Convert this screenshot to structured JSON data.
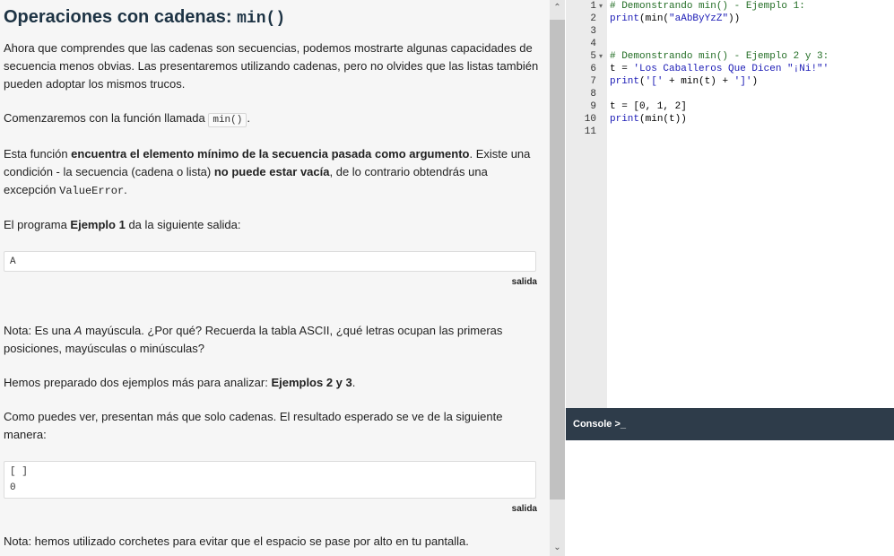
{
  "lesson": {
    "title_text": "Operaciones con cadenas: ",
    "title_code": "min()",
    "p1": "Ahora que comprendes que las cadenas son secuencias, podemos mostrarte algunas capacidades de secuencia menos obvias. Las presentaremos utilizando cadenas, pero no olvides que las listas también pueden adoptar los mismos trucos.",
    "p2_pre": "Comenzaremos con la función llamada ",
    "p2_code": "min()",
    "p2_post": ".",
    "p3_a": "Esta función ",
    "p3_b": "encuentra el elemento mínimo de la secuencia pasada como argumento",
    "p3_c": ". Existe una condición - la secuencia (cadena o lista) ",
    "p3_d": "no puede estar vacía",
    "p3_e": ", de lo contrario obtendrás una excepción ",
    "p3_code": "ValueError",
    "p3_f": ".",
    "p4_a": "El programa ",
    "p4_b": "Ejemplo 1",
    "p4_c": " da la siguiente salida:",
    "output1": "A",
    "output_label": "salida",
    "p5_a": "Nota: Es una ",
    "p5_em": "A",
    "p5_b": " mayúscula. ¿Por qué? Recuerda la tabla ASCII, ¿qué letras ocupan las primeras posiciones, mayúsculas o minúsculas?",
    "p6_a": "Hemos preparado dos ejemplos más para analizar: ",
    "p6_b": "Ejemplos 2 y 3",
    "p6_c": ".",
    "p7": "Como puedes ver, presentan más que solo cadenas. El resultado esperado se ve de la siguiente manera:",
    "output2_line1": "[ ]",
    "output2_line2": "0",
    "output2_label": "salida",
    "p8": "Nota: hemos utilizado corchetes para evitar que el espacio se pase por alto en tu pantalla."
  },
  "editor": {
    "line_numbers": [
      "1",
      "2",
      "3",
      "4",
      "5",
      "6",
      "7",
      "8",
      "9",
      "10",
      "11"
    ],
    "lines": {
      "l1": "# Demonstrando min() - Ejemplo 1:",
      "l2_kw": "print",
      "l2_a": "(min(",
      "l2_str": "\"aAbByYzZ\"",
      "l2_b": "))",
      "l5": "# Demonstrando min() - Ejemplo 2 y 3:",
      "l6_a": "t = ",
      "l6_str": "'Los Caballeros Que Dicen \"¡Ni!\"'",
      "l7_kw": "print",
      "l7_a": "(",
      "l7_s1": "'['",
      "l7_b": " + min(t) + ",
      "l7_s2": "']'",
      "l7_c": ")",
      "l9": "t = [0, 1, 2]",
      "l10_kw": "print",
      "l10_a": "(min(t))"
    }
  },
  "console": {
    "label": "Console >_"
  },
  "icons": {
    "scroll_up": "chevron-up-icon",
    "scroll_down": "chevron-down-icon",
    "fold": "fold-arrow-icon"
  }
}
